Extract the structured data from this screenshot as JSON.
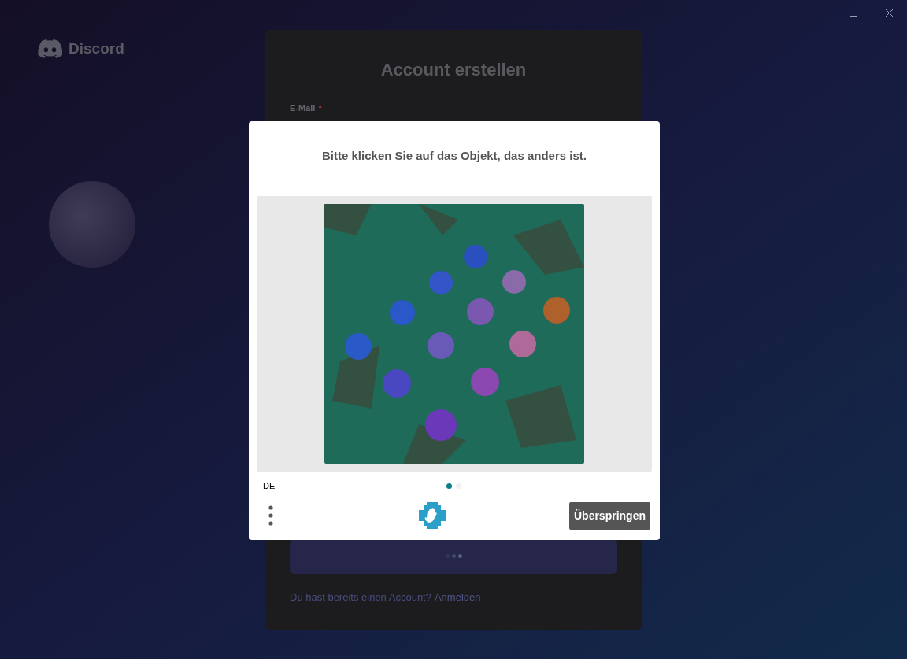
{
  "brand": {
    "name": "Discord"
  },
  "form": {
    "title": "Account erstellen",
    "fields": [
      {
        "label": "E-Mail",
        "required": true,
        "required_mark": "*"
      }
    ],
    "submit": {
      "loading": true
    },
    "login_prompt": "Du hast bereits einen Account?",
    "login_link": "Anmelden"
  },
  "captcha": {
    "prompt": "Bitte klicken Sie auf das Objekt, das anders ist.",
    "language": "DE",
    "pages": [
      {
        "selected": true
      },
      {
        "selected": false
      }
    ],
    "skip_button": "Überspringen"
  }
}
